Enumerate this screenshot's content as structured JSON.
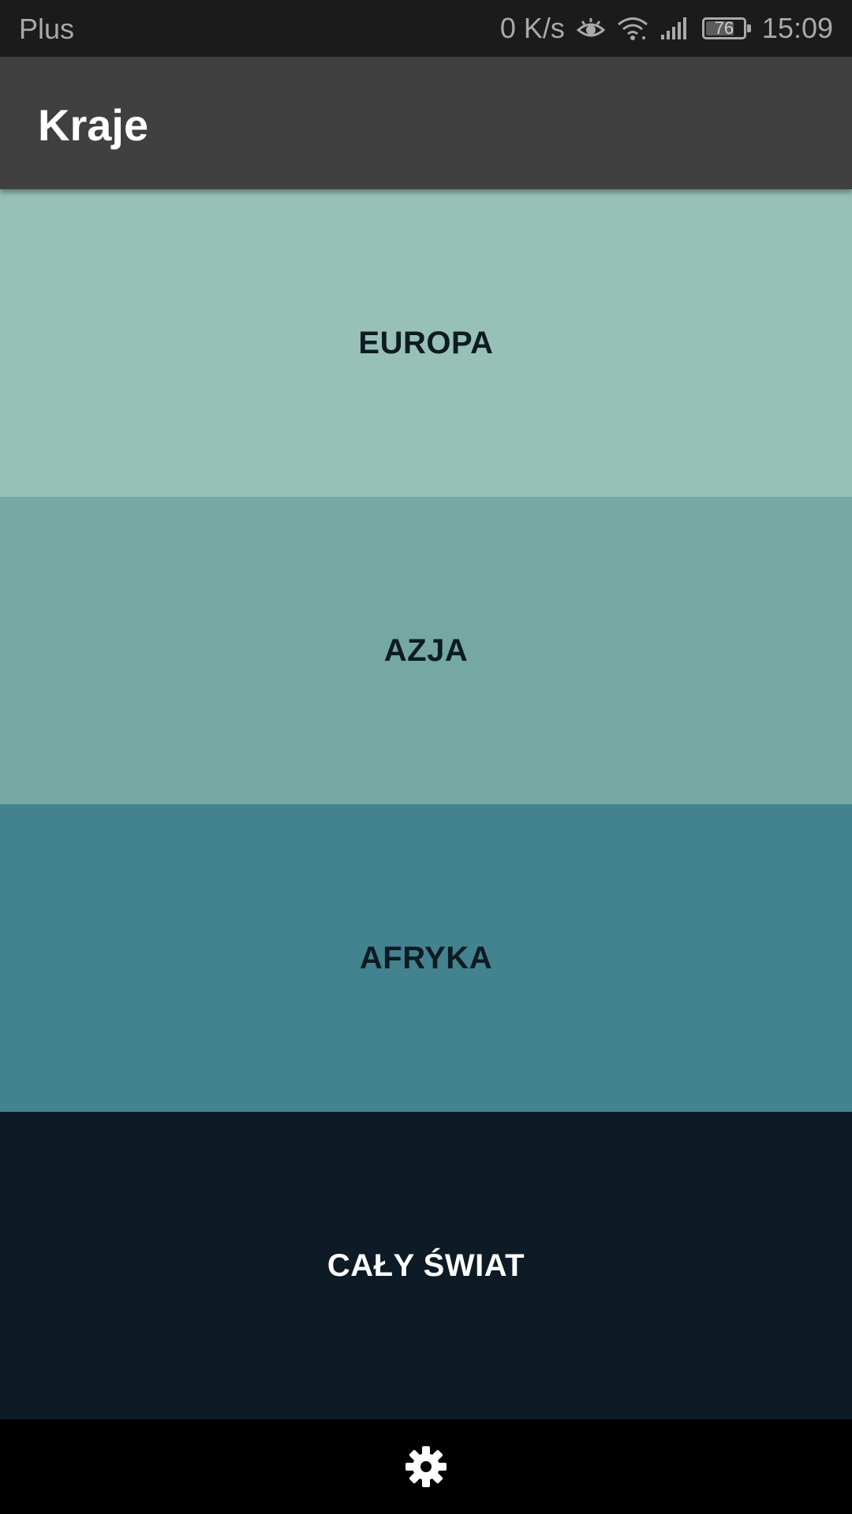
{
  "status_bar": {
    "carrier": "Plus",
    "network_speed": "0 K/s",
    "battery_level": "76",
    "battery_fraction": 0.76,
    "time": "15:09",
    "icons": [
      "eye-icon",
      "wifi-icon",
      "cell-signal-icon",
      "battery-icon"
    ]
  },
  "app_bar": {
    "title": "Kraje"
  },
  "regions": [
    {
      "label": "EUROPA",
      "color": "#97c1b6"
    },
    {
      "label": "AZJA",
      "color": "#75a8a2"
    },
    {
      "label": "AFRYKA",
      "color": "#43838f"
    },
    {
      "label": "CAŁY ŚWIAT",
      "color": "#0c1b26"
    }
  ],
  "bottom_bar": {
    "icon": "gear-icon"
  }
}
